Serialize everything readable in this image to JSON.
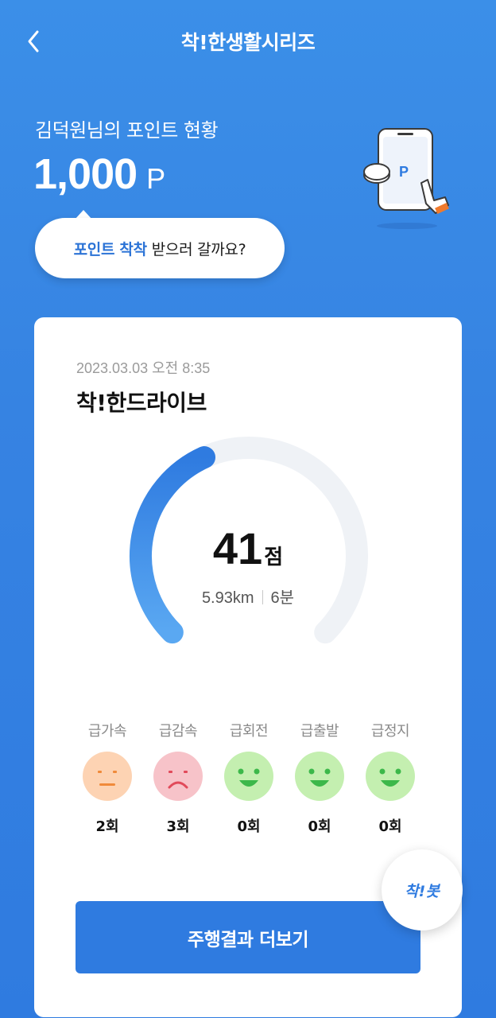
{
  "header": {
    "title": "착!한생활시리즈",
    "back_icon": "chevron-left-icon"
  },
  "points": {
    "label": "김덕원님의 포인트 현황",
    "value": "1,000",
    "unit": "P"
  },
  "illustration": {
    "icon": "phone-point-coin-icon",
    "phone_label": "P"
  },
  "bubble": {
    "accent_text": "포인트 착착",
    "rest_text": "받으러 갈까요?"
  },
  "card": {
    "date": "2023.03.03 오전 8:35",
    "title": "착!한드라이브",
    "score": "41",
    "score_unit": "점",
    "score_fraction": 0.41,
    "distance": "5.93km",
    "duration": "6분",
    "events": [
      {
        "label": "급가속",
        "count": "2회",
        "face": "neutral-face-icon",
        "color": "#fdd3b3"
      },
      {
        "label": "급감속",
        "count": "3회",
        "face": "sad-face-icon",
        "color": "#f7c3c9"
      },
      {
        "label": "급회전",
        "count": "0회",
        "face": "happy-face-icon",
        "color": "#c4efb0"
      },
      {
        "label": "급출발",
        "count": "0회",
        "face": "happy-face-icon",
        "color": "#c4efb0"
      },
      {
        "label": "급정지",
        "count": "0회",
        "face": "happy-face-icon",
        "color": "#c4efb0"
      }
    ],
    "more_button": "주행결과 더보기"
  },
  "fab": {
    "label": "착!봇"
  },
  "colors": {
    "background": "#3683e2",
    "accent": "#2f7be0",
    "gauge_track": "#eff2f6"
  }
}
